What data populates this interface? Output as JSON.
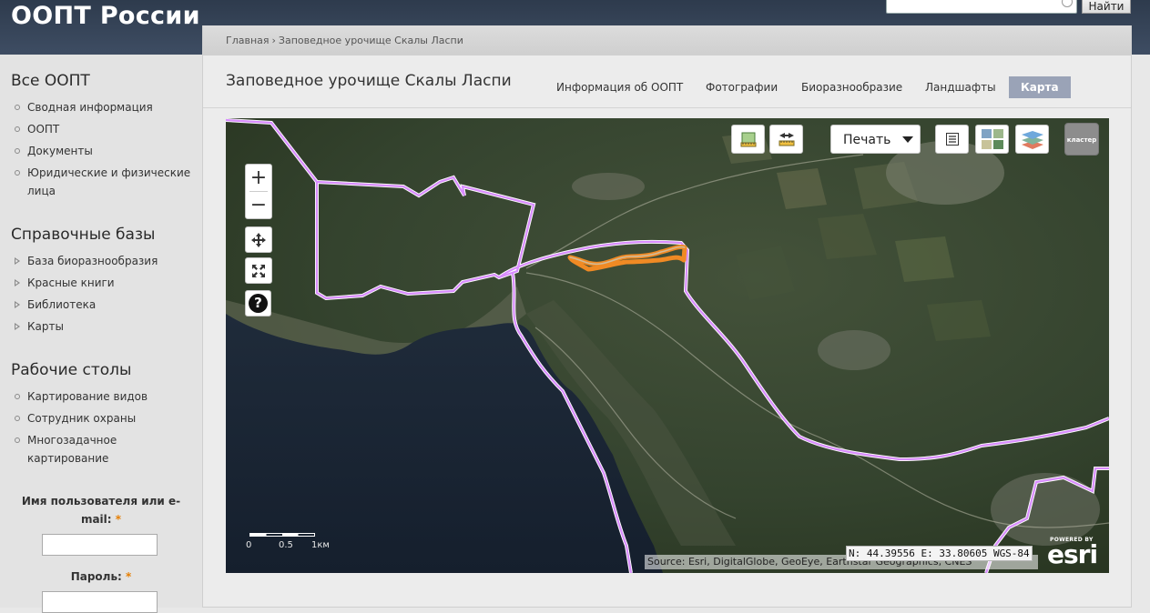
{
  "header": {
    "site_title": "ООПТ России",
    "search_placeholder": "",
    "search_button_label": "Найти"
  },
  "sidebar": {
    "sections": [
      {
        "heading": "Все ООПТ",
        "items": [
          "Сводная информация",
          "ООПТ",
          "Документы",
          "Юридические и физические лица"
        ]
      },
      {
        "heading": "Справочные базы",
        "items": [
          "База биоразнообразия",
          "Красные книги",
          "Библиотека",
          "Карты"
        ]
      },
      {
        "heading": "Рабочие столы",
        "items": [
          "Картирование видов",
          "Сотрудник охраны",
          "Многозадачное картирование"
        ]
      }
    ],
    "login": {
      "username_label": "Имя пользователя или e-mail:",
      "password_label": "Пароль:",
      "required_mark": "*"
    }
  },
  "breadcrumb": {
    "items": [
      "Главная",
      "Заповедное урочище Скалы Ласпи"
    ],
    "separator": "›"
  },
  "page": {
    "title": "Заповедное урочище Скалы Ласпи",
    "tabs": [
      "Информация об ООПТ",
      "Фотографии",
      "Биоразнообразие",
      "Ландшафты",
      "Карта"
    ],
    "active_tab": "Карта"
  },
  "map": {
    "zoom_in_label": "+",
    "zoom_out_label": "−",
    "help_label": "?",
    "print_label": "Печать",
    "cluster_label": "кластер",
    "scale_labels": [
      "0",
      "0.5",
      "1км"
    ],
    "attribution": "Source: Esri, DigitalGlobe, GeoEye, Earthstar Geographics, CNES",
    "coordinates": "N: 44.39556 E: 33.80605 WGS-84",
    "esri_powered": "POWERED BY",
    "esri_name": "esri",
    "colors": {
      "boundary": "#d88cff",
      "highlight": "#f08a24",
      "sea": "#1a2637",
      "forest": "#2c3a27"
    },
    "tool_icons": [
      "measure-area-icon",
      "measure-distance-icon",
      "legend-list-icon",
      "basemap-gallery-icon",
      "layers-icon"
    ]
  }
}
